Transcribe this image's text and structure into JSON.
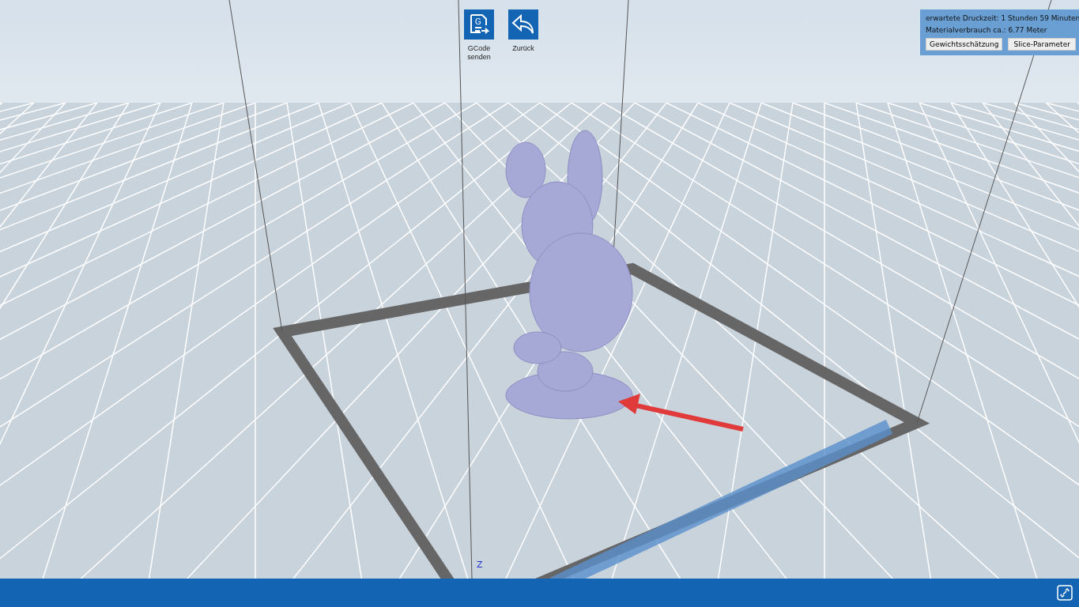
{
  "toolbar": [
    {
      "kind": "gcode",
      "icon_text": "G",
      "label": "GCode\nsenden"
    },
    {
      "kind": "back",
      "label": "Zurück"
    }
  ],
  "info_panel": {
    "print_time": "erwartete Druckzeit: 1 Stunden 59 Minuten",
    "material": "Materialverbrauch ca.: 6.77 Meter",
    "buttons": [
      "Gewichtsschätzung",
      "Slice-Parameter"
    ]
  },
  "viewport": {
    "axis_label": "Z"
  }
}
